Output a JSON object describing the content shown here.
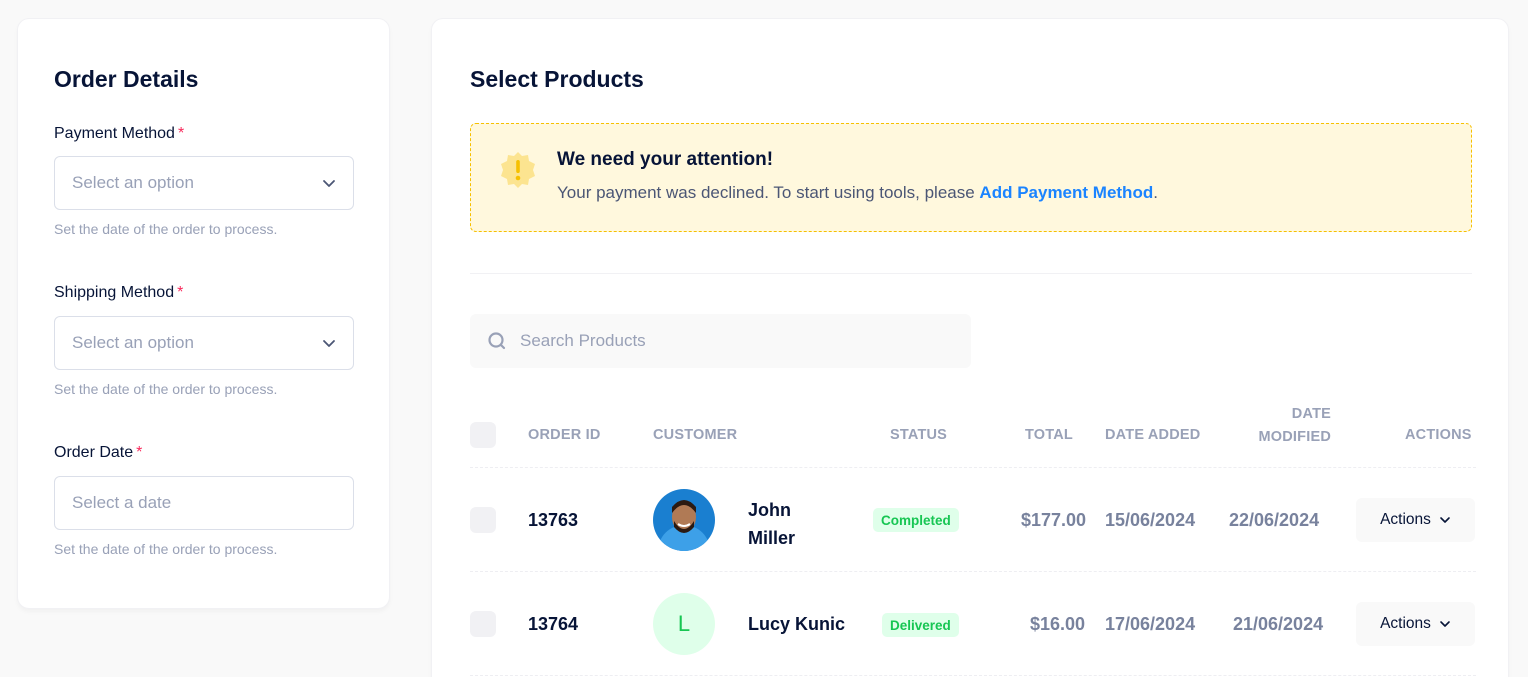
{
  "order_details": {
    "title": "Order Details",
    "required_mark": "*",
    "payment": {
      "label": "Payment Method",
      "placeholder": "Select an option",
      "hint": "Set the date of the order to process."
    },
    "shipping": {
      "label": "Shipping Method",
      "placeholder": "Select an option",
      "hint": "Set the date of the order to process."
    },
    "order_date": {
      "label": "Order Date",
      "placeholder": "Select a date",
      "hint": "Set the date of the order to process."
    }
  },
  "products": {
    "title": "Select Products",
    "notice": {
      "title": "We need your attention!",
      "text": "Your payment was declined. To start using tools, please ",
      "link": "Add Payment Method",
      "suffix": "."
    },
    "search_placeholder": "Search Products",
    "columns": {
      "order_id": "Order ID",
      "customer": "Customer",
      "status": "Status",
      "total": "Total",
      "date_added": "Date Added",
      "date_modified_line1": "Date",
      "date_modified_line2": "Modified",
      "actions": "Actions"
    },
    "rows": [
      {
        "order_id": "13763",
        "customer_first": "John",
        "customer_last": "Miller",
        "status": "Completed",
        "total": "$177.00",
        "date_added": "15/06/2024",
        "date_modified": "22/06/2024",
        "actions": "Actions"
      },
      {
        "order_id": "13764",
        "avatar_letter": "L",
        "customer": "Lucy Kunic",
        "status": "Delivered",
        "total": "$16.00",
        "date_added": "17/06/2024",
        "date_modified": "21/06/2024",
        "actions": "Actions"
      }
    ]
  },
  "colors": {
    "heading": "#071437",
    "muted": "#99a1b7",
    "required": "#f8285a",
    "link": "#1b84ff",
    "warning_bg": "#fff8dd",
    "warning_border": "#f6c000",
    "success": "#17c653",
    "success_bg": "#dfffea"
  }
}
